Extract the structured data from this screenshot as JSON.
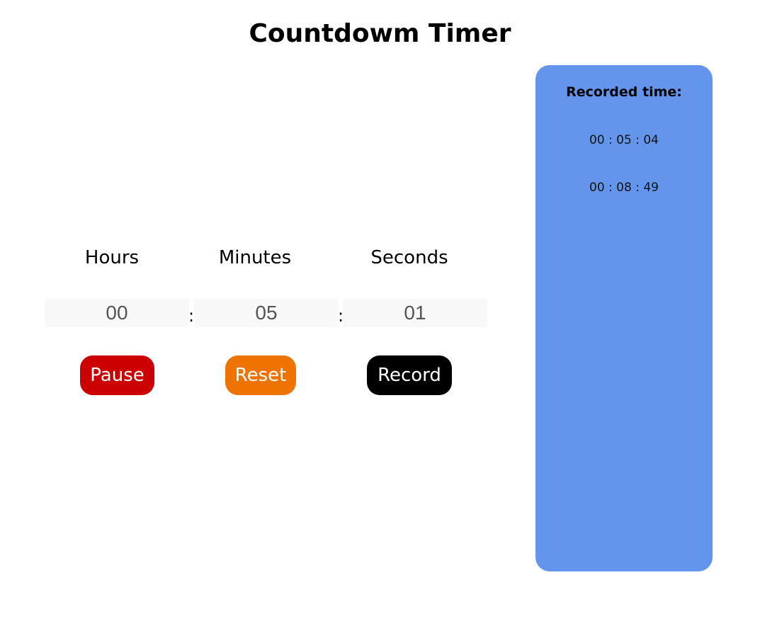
{
  "page": {
    "title": "Countdowm Timer"
  },
  "timer": {
    "labels": {
      "hours": "Hours",
      "minutes": "Minutes",
      "seconds": "Seconds"
    },
    "values": {
      "hours": "00",
      "minutes": "05",
      "seconds": "01"
    },
    "separator": ":"
  },
  "controls": {
    "pause_label": "Pause",
    "reset_label": "Reset",
    "record_label": "Record"
  },
  "recorded": {
    "title": "Recorded time:",
    "items": [
      "00 : 05 : 04",
      "00 : 08 : 49"
    ]
  },
  "colors": {
    "pause": "#cc0000",
    "reset": "#ee7300",
    "record": "#000000",
    "panel": "#6495ed"
  }
}
